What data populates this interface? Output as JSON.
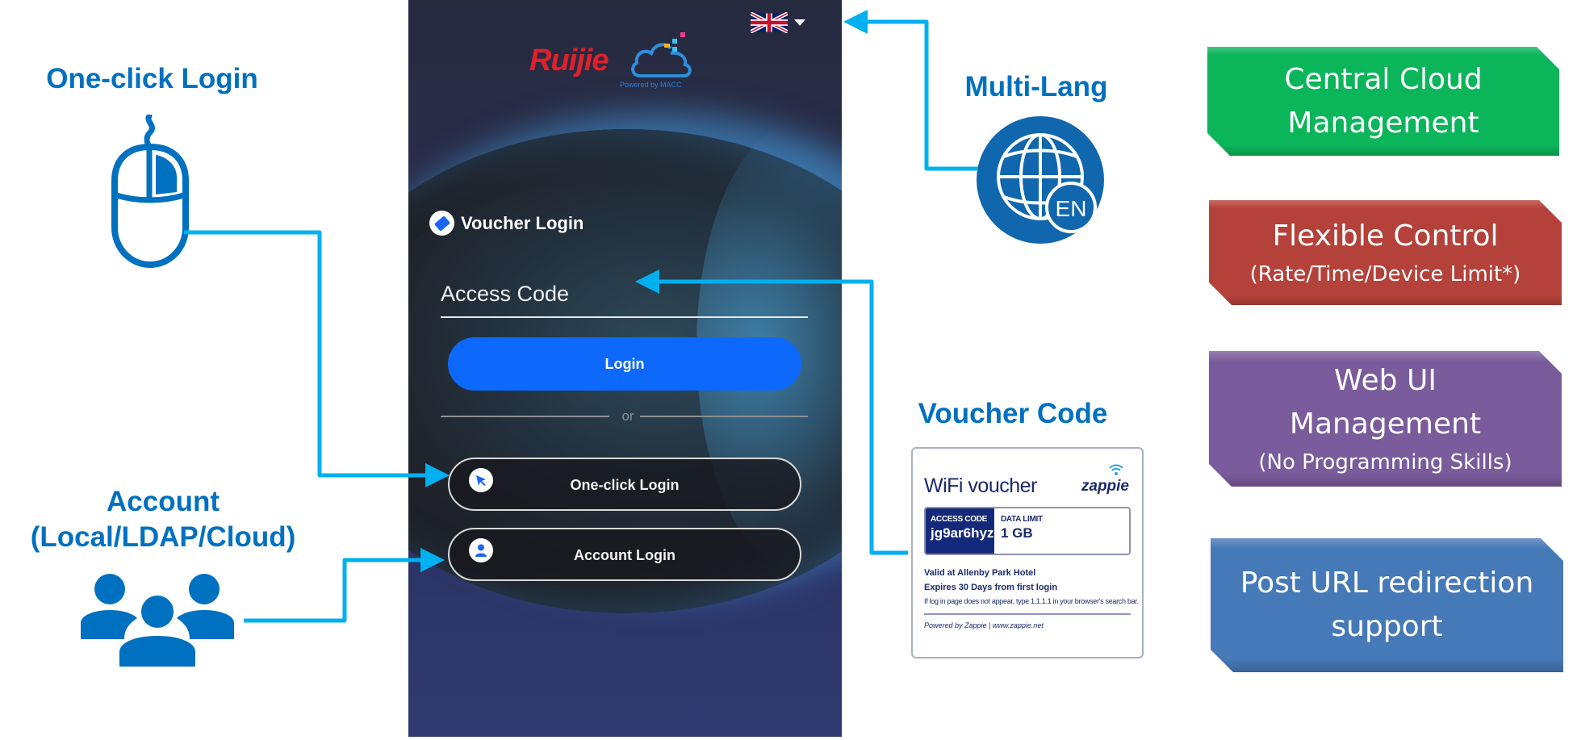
{
  "annotations": {
    "one_click_login": "One-click Login",
    "account_line1": "Account",
    "account_line2": "(Local/LDAP/Cloud)",
    "multi_lang": "Multi-Lang",
    "voucher_code": "Voucher Code"
  },
  "icons": {
    "mouse": "mouse-icon",
    "users": "users-group-icon",
    "globe": "globe-language-icon",
    "globe_label": "EN"
  },
  "login_page": {
    "language": "English (UK flag)",
    "logo_text": "Ruijie",
    "logo_powered": "Powered by MACC",
    "voucher_header": "Voucher Login",
    "access_code_placeholder": "Access Code",
    "login_button": "Login",
    "separator": "or",
    "oneclick_button": "One-click Login",
    "account_button": "Account Login"
  },
  "voucher_card": {
    "title": "WiFi voucher",
    "brand": "zappie",
    "access_code_label": "ACCESS CODE",
    "access_code_value": "jg9ar6hyz",
    "data_limit_label": "DATA LIMIT",
    "data_limit_value": "1 GB",
    "valid_at": "Valid at Allenby Park Hotel",
    "expires": "Expires 30 Days from first login",
    "note": "If log in page does not appear, type 1.1.1.1 in your browser's search bar.",
    "powered": "Powered by Zappie | www.zappie.net"
  },
  "features": [
    {
      "main": [
        "Central Cloud",
        "Management"
      ],
      "sub": "",
      "color": "#0bb55a"
    },
    {
      "main": [
        "Flexible Control"
      ],
      "sub": "(Rate/Time/Device Limit*)",
      "color": "#b4423a"
    },
    {
      "main": [
        "Web UI",
        "Management"
      ],
      "sub": "(No Programming Skills)",
      "color": "#7a5b9c"
    },
    {
      "main": [
        "Post URL redirection",
        "support"
      ],
      "sub": "",
      "color": "#4679b7"
    }
  ],
  "colors": {
    "annotation_blue": "#0070c0",
    "connector": "#00b0f0",
    "login_button": "#0d69fb"
  }
}
